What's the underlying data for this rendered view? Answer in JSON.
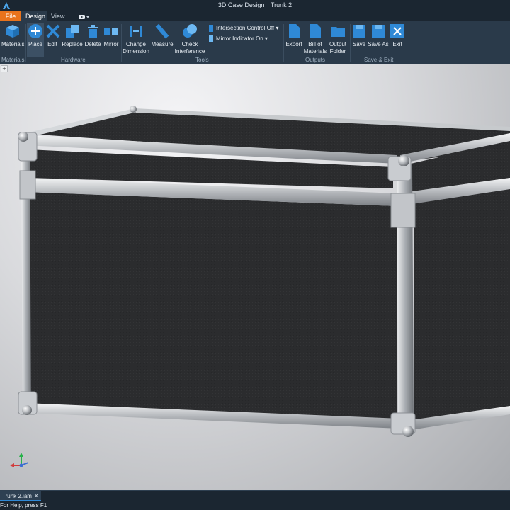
{
  "window": {
    "app_name": "3D Case Design",
    "document_name": "Trunk 2"
  },
  "tabs": {
    "file": "File",
    "design": "Design",
    "view": "View"
  },
  "ribbon": {
    "materials": "Materials",
    "place": "Place",
    "edit": "Edit",
    "replace": "Replace",
    "delete": "Delete",
    "mirror": "Mirror",
    "change_dimension": [
      "Change",
      "Dimension"
    ],
    "measure": "Measure",
    "check_interference": [
      "Check",
      "Interference"
    ],
    "intersection_control": "Intersection Control Off",
    "mirror_indicator": "Mirror Indicator On",
    "export": "Export",
    "bill_of_materials": [
      "Bill of",
      "Materials"
    ],
    "output_folder": [
      "Output",
      "Folder"
    ],
    "save": "Save",
    "save_as": "Save As",
    "exit": "Exit",
    "groups": {
      "materials": "Materials",
      "hardware": "Hardware",
      "tools": "Tools",
      "outputs": "Outputs",
      "save_exit": "Save & Exit"
    }
  },
  "document_tab": {
    "label": "Trunk 2.iam",
    "close": "✕"
  },
  "status": {
    "help": "For Help, press F1"
  },
  "colors": {
    "accent": "#2f89d6",
    "file_tab": "#e8731c",
    "ribbon": "#2a3a4a"
  }
}
